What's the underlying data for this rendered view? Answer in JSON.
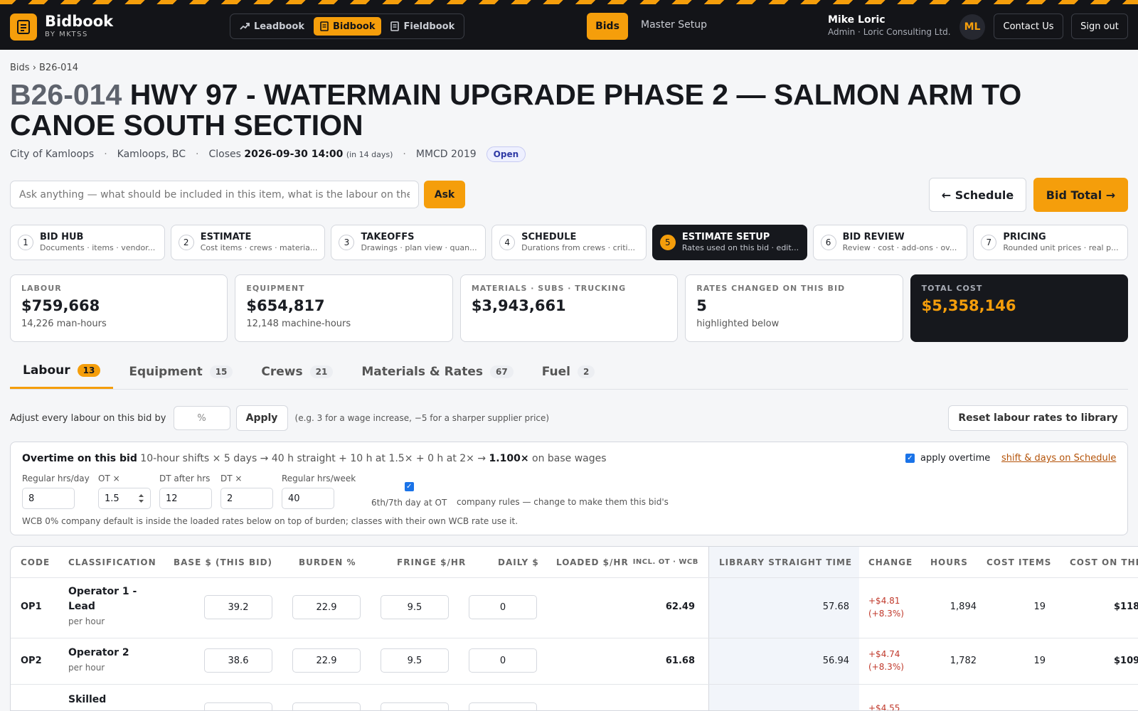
{
  "header": {
    "brand": "Bidbook",
    "brand_sub": "BY MKTSS",
    "apps": [
      {
        "label": "Leadbook",
        "icon": "trend-icon"
      },
      {
        "label": "Bidbook",
        "icon": "book-icon"
      },
      {
        "label": "Fieldbook",
        "icon": "document-icon"
      }
    ],
    "nav_bids": "Bids",
    "nav_master": "Master Setup",
    "user_name": "Mike Loric",
    "user_role": "Admin · Loric Consulting Ltd.",
    "avatar_initials": "ML",
    "contact": "Contact Us",
    "signout": "Sign out"
  },
  "breadcrumb": "Bids › B26-014",
  "bid": {
    "code": "B26-014",
    "title": "HWY 97 - WATERMAIN UPGRADE PHASE 2 — SALMON ARM TO CANOE SOUTH SECTION",
    "owner": "City of Kamloops",
    "location": "Kamloops, BC",
    "closes_label": "Closes",
    "closes": "2026-09-30 14:00",
    "closes_rel": "(in 14 days)",
    "spec": "MMCD 2019",
    "status": "Open"
  },
  "ask": {
    "placeholder": "Ask anything — what should be included in this item, what is the labour on the w",
    "button": "Ask"
  },
  "actions": {
    "schedule": "← Schedule",
    "bid_total": "Bid Total →"
  },
  "steps": [
    {
      "num": "1",
      "title": "BID HUB",
      "desc": "Documents · items · vendor..."
    },
    {
      "num": "2",
      "title": "ESTIMATE",
      "desc": "Cost items · crews · materia..."
    },
    {
      "num": "3",
      "title": "TAKEOFFS",
      "desc": "Drawings · plan view · quan..."
    },
    {
      "num": "4",
      "title": "SCHEDULE",
      "desc": "Durations from crews · criti..."
    },
    {
      "num": "5",
      "title": "ESTIMATE SETUP",
      "desc": "Rates used on this bid · edit..."
    },
    {
      "num": "6",
      "title": "BID REVIEW",
      "desc": "Review · cost · add-ons · ov..."
    },
    {
      "num": "7",
      "title": "PRICING",
      "desc": "Rounded unit prices · real p..."
    }
  ],
  "summary": [
    {
      "label": "LABOUR",
      "value": "$759,668",
      "sub": "14,226 man-hours"
    },
    {
      "label": "EQUIPMENT",
      "value": "$654,817",
      "sub": "12,148 machine-hours"
    },
    {
      "label": "MATERIALS · SUBS · TRUCKING",
      "value": "$3,943,661",
      "sub": ""
    },
    {
      "label": "RATES CHANGED ON THIS BID",
      "value": "5",
      "sub": "highlighted below"
    },
    {
      "label": "TOTAL COST",
      "value": "$5,358,146",
      "sub": ""
    }
  ],
  "tabs": [
    {
      "label": "Labour",
      "count": "13"
    },
    {
      "label": "Equipment",
      "count": "15"
    },
    {
      "label": "Crews",
      "count": "21"
    },
    {
      "label": "Materials & Rates",
      "count": "67"
    },
    {
      "label": "Fuel",
      "count": "2"
    }
  ],
  "adjust": {
    "label": "Adjust every labour on this bid by",
    "unit": "%",
    "apply": "Apply",
    "hint": "(e.g. 3 for a wage increase, −5 for a sharper supplier price)",
    "reset": "Reset labour rates to library"
  },
  "overtime": {
    "title": "Overtime on this bid",
    "desc": "10-hour shifts × 5 days → 40 h straight + 10 h at 1.5× + 0 h at 2× →",
    "factor": "1.100×",
    "desc_end": "on base wages",
    "apply_label": "apply overtime",
    "link": "shift & days on Schedule",
    "fields": [
      {
        "label": "Regular hrs/day",
        "value": "8"
      },
      {
        "label": "OT ×",
        "value": "1.5"
      },
      {
        "label": "DT after hrs",
        "value": "12"
      },
      {
        "label": "DT ×",
        "value": "2"
      },
      {
        "label": "Regular hrs/week",
        "value": "40"
      }
    ],
    "sixth_label": "6th/7th day at OT",
    "rules_note": "company rules — change to make them this bid's",
    "wcb_note": "WCB 0% company default is inside the loaded rates below on top of burden; classes with their own WCB rate use it."
  },
  "table": {
    "headers": {
      "code": "CODE",
      "classification": "CLASSIFICATION",
      "base": "BASE $ (THIS BID)",
      "burden": "BURDEN %",
      "fringe": "FRINGE $/HR",
      "daily": "DAILY $",
      "loaded": "LOADED $/HR",
      "loaded_note": "INCL. OT · WCB",
      "library": "LIBRARY STRAIGHT TIME",
      "change": "CHANGE",
      "hours": "HOURS",
      "cost_items": "COST ITEMS",
      "cost_on": "COST ON THI"
    },
    "rows": [
      {
        "code": "OP1",
        "name": "Operator 1 - Lead",
        "unit": "per hour",
        "base": "39.2",
        "burden": "22.9",
        "fringe": "9.5",
        "daily": "0",
        "loaded": "62.49",
        "library": "57.68",
        "change": "+$4.81",
        "change_pct": "(+8.3%)",
        "hours": "1,894",
        "items": "19",
        "cost": "$118"
      },
      {
        "code": "OP2",
        "name": "Operator 2",
        "unit": "per hour",
        "base": "38.6",
        "burden": "22.9",
        "fringe": "9.5",
        "daily": "0",
        "loaded": "61.68",
        "library": "56.94",
        "change": "+$4.74",
        "change_pct": "(+8.3%)",
        "hours": "1,782",
        "items": "19",
        "cost": "$109"
      },
      {
        "code": "",
        "name": "Skilled",
        "unit": "",
        "base": "",
        "burden": "",
        "fringe": "",
        "daily": "",
        "loaded": "",
        "library": "",
        "change": "+$4.55",
        "change_pct": "",
        "hours": "",
        "items": "",
        "cost": ""
      }
    ]
  },
  "colors": {
    "accent": "#f59e0b",
    "dark": "#131418",
    "change": "#c0392b"
  }
}
